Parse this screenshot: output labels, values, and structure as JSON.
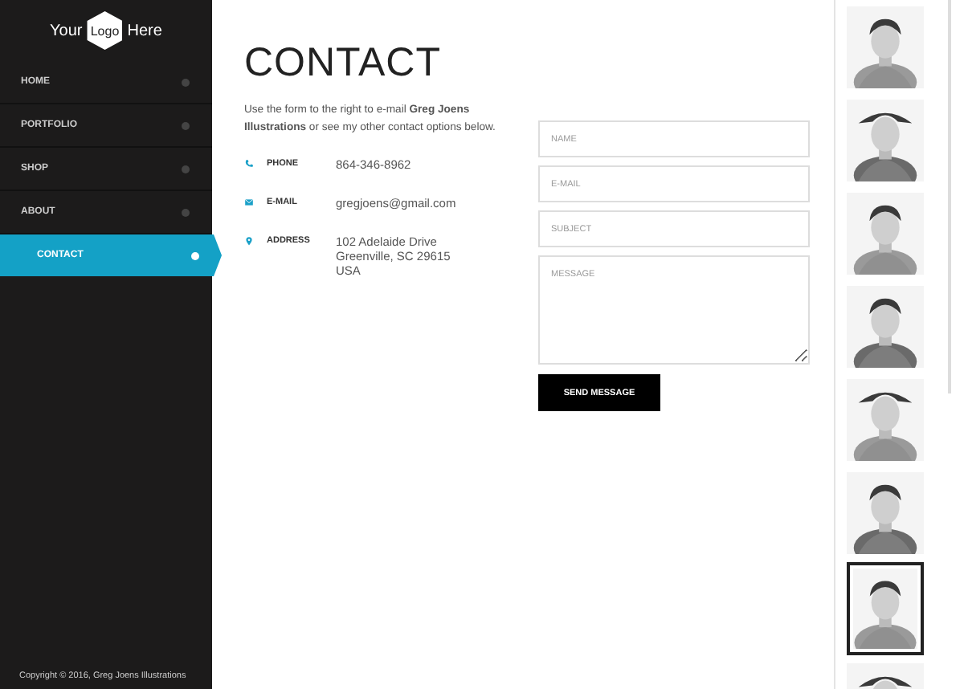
{
  "logo": {
    "before": "Your",
    "mark": "Logo",
    "after": "Here"
  },
  "nav": [
    {
      "label": "HOME",
      "selected": false
    },
    {
      "label": "PORTFOLIO",
      "selected": false
    },
    {
      "label": "SHOP",
      "selected": false
    },
    {
      "label": "ABOUT",
      "selected": false
    },
    {
      "label": "CONTACT",
      "selected": true
    }
  ],
  "copyright": "Copyright © 2016, Greg Joens Illustrations",
  "title": "CONTACT",
  "intro": "Use the form to the right to e-mail **Greg Joens Illustrations** or see my other contact options below.",
  "contacts": [
    {
      "kind": "phone",
      "label": "PHONE",
      "lines": [
        "864-346-8962"
      ]
    },
    {
      "kind": "email",
      "label": "E-MAIL",
      "lines": [
        "gregjoens@gmail.com"
      ]
    },
    {
      "kind": "address",
      "label": "ADDRESS",
      "lines": [
        "102 Adelaide Drive",
        "Greenville, SC 29615",
        "USA"
      ]
    }
  ],
  "form": {
    "fields": [
      {
        "kind": "input",
        "placeholder": "NAME"
      },
      {
        "kind": "input",
        "placeholder": "E-MAIL"
      },
      {
        "kind": "input",
        "placeholder": "SUBJECT"
      },
      {
        "kind": "textarea",
        "placeholder": "MESSAGE"
      }
    ],
    "button": "SEND MESSAGE"
  },
  "thumbnails": [
    {
      "kind": "picture",
      "selected": false
    },
    {
      "kind": "picture",
      "selected": false
    },
    {
      "kind": "picture",
      "selected": false
    },
    {
      "kind": "picture",
      "selected": false
    },
    {
      "kind": "picture",
      "selected": false
    },
    {
      "kind": "picture",
      "selected": false
    },
    {
      "kind": "picture",
      "selected": true
    },
    {
      "kind": "picture",
      "selected": false
    }
  ]
}
